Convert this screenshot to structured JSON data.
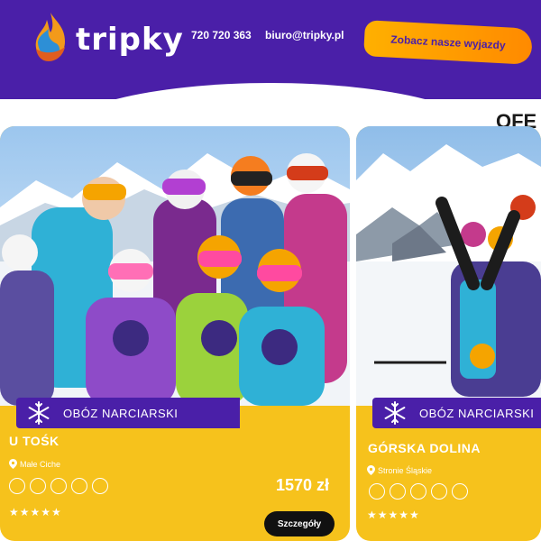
{
  "header": {
    "brand": "tripky",
    "phone": "720 720 363",
    "email": "biuro@tripky.pl",
    "cta_label": "Zobacz nasze wyjazdy"
  },
  "section": {
    "title": "OFE"
  },
  "colors": {
    "header_bg": "#4a1fa8",
    "card_bg": "#f6c21c",
    "cta_gradient_start": "#ffb000",
    "cta_gradient_end": "#ff8a00",
    "details_button_bg": "#111111"
  },
  "cards": [
    {
      "category": "OBÓZ NARCIARSKI",
      "title": "U TOŚK",
      "location": "Małe Ciche",
      "price": "1570 zł",
      "rating_stars": "★★★★★",
      "details_label": "Szczegóły",
      "icons": [
        "ski-icon",
        "bed-icon",
        "mountain-icon",
        "bus-icon",
        "food-icon"
      ]
    },
    {
      "category": "OBÓZ NARCIARSKI",
      "title": "GÓRSKA DOLINA",
      "location": "Stronie Śląskie",
      "rating_stars": "★★★★★",
      "icons": [
        "ski-icon",
        "bed-icon",
        "mountain-icon",
        "bus-icon",
        "food-icon"
      ]
    }
  ]
}
